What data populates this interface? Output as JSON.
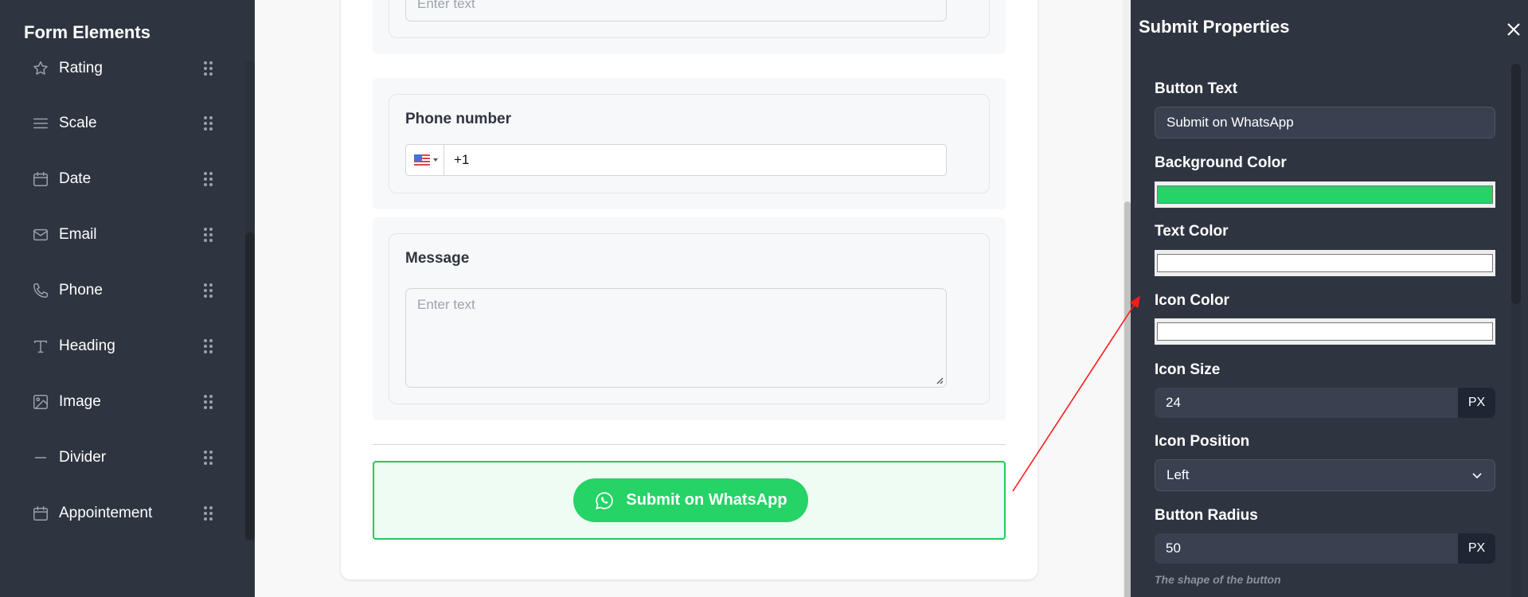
{
  "sidebar": {
    "title": "Form Elements",
    "items": [
      {
        "label": "Rating",
        "icon": "star-icon"
      },
      {
        "label": "Scale",
        "icon": "menu-lines-icon"
      },
      {
        "label": "Date",
        "icon": "calendar-icon"
      },
      {
        "label": "Email",
        "icon": "mail-icon"
      },
      {
        "label": "Phone",
        "icon": "phone-icon"
      },
      {
        "label": "Heading",
        "icon": "text-t-icon"
      },
      {
        "label": "Image",
        "icon": "image-icon"
      },
      {
        "label": "Divider",
        "icon": "minus-icon"
      },
      {
        "label": "Appointement",
        "icon": "calendar-icon"
      }
    ]
  },
  "form": {
    "top_field": {
      "placeholder": "Enter text"
    },
    "phone_field": {
      "label": "Phone number",
      "country_flag": "US",
      "value": "+1"
    },
    "message_field": {
      "label": "Message",
      "placeholder": "Enter text"
    },
    "submit_button": {
      "label": "Submit on WhatsApp",
      "icon": "whatsapp-icon",
      "background": "#25d366",
      "text_color": "#ffffff"
    }
  },
  "properties": {
    "title": "Submit Properties",
    "close_icon": "close-icon",
    "button_text": {
      "label": "Button Text",
      "value": "Submit on WhatsApp"
    },
    "background_color": {
      "label": "Background Color",
      "value": "#25d366"
    },
    "text_color": {
      "label": "Text Color",
      "value": "#ffffff"
    },
    "icon_color": {
      "label": "Icon Color",
      "value": "#ffffff"
    },
    "icon_size": {
      "label": "Icon Size",
      "value": "24",
      "unit": "PX"
    },
    "icon_position": {
      "label": "Icon Position",
      "value": "Left"
    },
    "button_radius": {
      "label": "Button Radius",
      "value": "50",
      "unit": "PX",
      "help": "The shape of the button"
    }
  }
}
